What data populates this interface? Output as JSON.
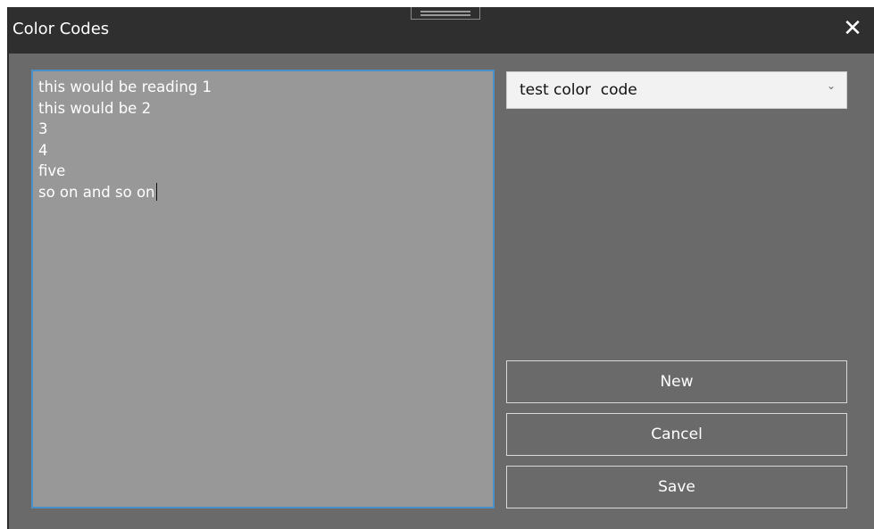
{
  "window": {
    "title": "Color Codes",
    "close_glyph": "✕"
  },
  "editor": {
    "lines": [
      "this would be reading 1",
      "this would be 2",
      "3",
      "4",
      "five",
      "so on and so on"
    ]
  },
  "dropdown": {
    "selected": "test color  code",
    "chevron_icon": "chevron-down-icon"
  },
  "buttons": {
    "new_label": "New",
    "cancel_label": "Cancel",
    "save_label": "Save"
  },
  "colors": {
    "titlebar": "#2f2f2f",
    "window_bg": "#6a6a6a",
    "editor_bg": "#989898",
    "focus_border": "#4a90c9"
  }
}
